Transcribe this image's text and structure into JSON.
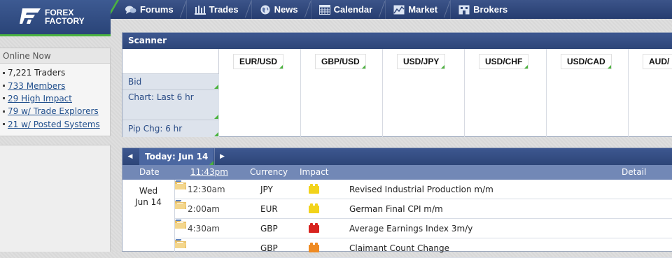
{
  "brand": {
    "line1": "FOREX",
    "line2": "FACTORY"
  },
  "nav": [
    {
      "label": "Forums",
      "icon": "speech-bubbles-icon"
    },
    {
      "label": "Trades",
      "icon": "bar-chart-icon"
    },
    {
      "label": "News",
      "icon": "globe-icon"
    },
    {
      "label": "Calendar",
      "icon": "calendar-grid-icon"
    },
    {
      "label": "Market",
      "icon": "line-chart-icon"
    },
    {
      "label": "Brokers",
      "icon": "building-icon"
    }
  ],
  "online": {
    "title": "Online Now",
    "items": [
      {
        "label": "7,221 Traders",
        "link": false
      },
      {
        "label": "733 Members",
        "link": true
      },
      {
        "label": "29 High Impact",
        "link": true
      },
      {
        "label": "79 w/ Trade Explorers",
        "link": true
      },
      {
        "label": "21 w/ Posted Systems",
        "link": true
      }
    ]
  },
  "scanner": {
    "title": "Scanner",
    "rows": [
      "Bid",
      "Chart: Last 6 hr",
      "Pip Chg: 6 hr"
    ],
    "pairs": [
      "EUR/USD",
      "GBP/USD",
      "USD/JPY",
      "USD/CHF",
      "USD/CAD",
      "AUD/"
    ]
  },
  "calendar": {
    "prev_arrow": "◀",
    "next_arrow": "▶",
    "today_label": "Today: Jun 14",
    "columns": {
      "date": "Date",
      "time": "11:43pm",
      "currency": "Currency",
      "impact": "Impact",
      "detail": "Detail"
    },
    "day": {
      "weekday": "Wed",
      "date": "Jun 14"
    },
    "events": [
      {
        "time": "12:30am",
        "currency": "JPY",
        "impact": "low",
        "impact_color": "#f2d31b",
        "name": "Revised Industrial Production m/m"
      },
      {
        "time": "2:00am",
        "currency": "EUR",
        "impact": "low",
        "impact_color": "#f2d31b",
        "name": "German Final CPI m/m"
      },
      {
        "time": "4:30am",
        "currency": "GBP",
        "impact": "high",
        "impact_color": "#d8231f",
        "name": "Average Earnings Index 3m/y"
      },
      {
        "time": "",
        "currency": "GBP",
        "impact": "medium",
        "impact_color": "#ef8a22",
        "name": "Claimant Count Change"
      }
    ]
  },
  "colors": {
    "nav_blue": "#2d4578",
    "accent_green": "#4bb33f",
    "link_blue": "#1f4e8c",
    "column_header": "#7288b6"
  }
}
